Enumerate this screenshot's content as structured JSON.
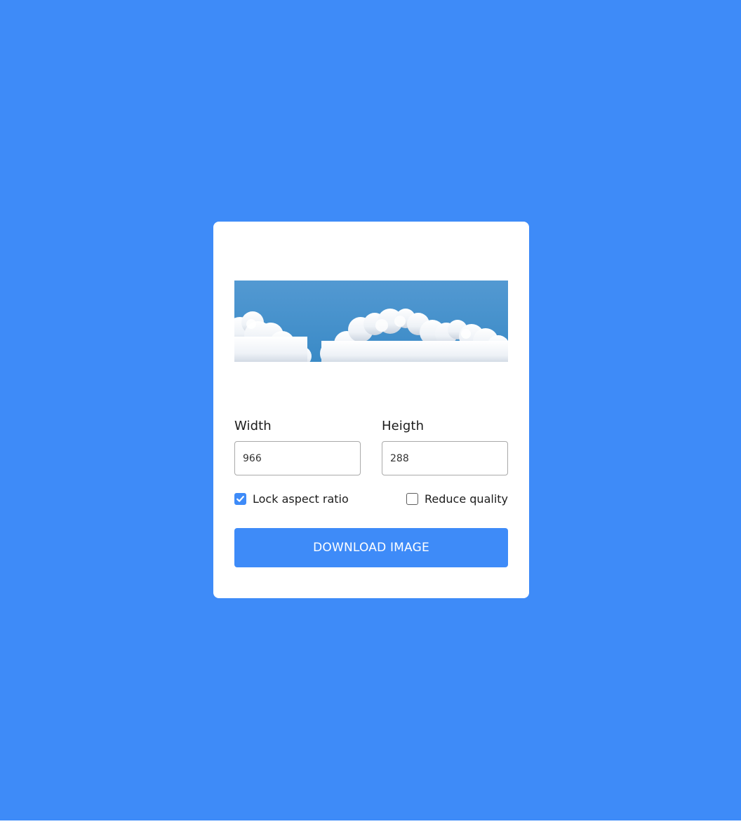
{
  "colors": {
    "background": "#3e8bf8",
    "card": "#ffffff",
    "accent": "#3e8bf8",
    "text": "#1c1c1c"
  },
  "preview": {
    "alt": "clouds"
  },
  "width_field": {
    "label": "Width",
    "value": "966"
  },
  "height_field": {
    "label": "Heigth",
    "value": "288"
  },
  "options": {
    "lock_aspect": {
      "label": "Lock aspect ratio",
      "checked": true
    },
    "reduce_quality": {
      "label": "Reduce quality",
      "checked": false
    }
  },
  "download_button": {
    "label": "DOWNLOAD IMAGE"
  },
  "icons": {
    "check": "checkmark-icon"
  }
}
